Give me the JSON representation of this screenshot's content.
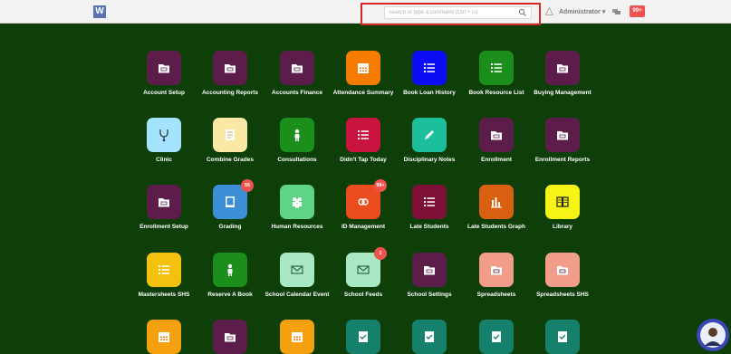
{
  "navbar": {
    "logo": "W",
    "search_placeholder": "Search or type a command (Ctrl + G)",
    "user": "Administrator ▾",
    "notifications": "99+"
  },
  "colors": {
    "background": "#0e3f08",
    "plum": "#5c1d4b",
    "orange": "#f57c00",
    "blue": "#0b0ef4",
    "green": "#1b8e1c",
    "cyan": "#a5e4ff",
    "cream": "#fbe8a5",
    "crimson": "#c8143e",
    "teal": "#1bbf9c",
    "skyblue": "#3b8fd6",
    "mint": "#5fd486",
    "redorange": "#eb4b1e",
    "maroon": "#7e1038",
    "burntorange": "#d96011",
    "yellow": "#f6f316",
    "gold": "#f5c10f",
    "palemint": "#a9e8c5",
    "salmon": "#f29d8a",
    "darkteal": "#15806c"
  },
  "tiles": [
    {
      "label": "Account Setup",
      "icon": "folder-icon",
      "color": "#5c1d4b"
    },
    {
      "label": "Accounting Reports",
      "icon": "folder-icon",
      "color": "#5c1d4b"
    },
    {
      "label": "Accounts Finance",
      "icon": "folder-icon",
      "color": "#5c1d4b"
    },
    {
      "label": "Attendance Summary",
      "icon": "calendar-icon",
      "color": "#f57c00"
    },
    {
      "label": "Book Loan History",
      "icon": "list-icon",
      "color": "#0b0ef4"
    },
    {
      "label": "Book Resource List",
      "icon": "list-icon",
      "color": "#1b8e1c"
    },
    {
      "label": "Buying Management",
      "icon": "folder-icon",
      "color": "#5c1d4b"
    },
    {
      "label": "Clinic",
      "icon": "stethoscope-icon",
      "color": "#a5e4ff"
    },
    {
      "label": "Combine Grades",
      "icon": "note-icon",
      "color": "#fbe8a5"
    },
    {
      "label": "Consultations",
      "icon": "person-icon",
      "color": "#1b8e1c"
    },
    {
      "label": "Didn't Tap Today",
      "icon": "list-icon",
      "color": "#c8143e"
    },
    {
      "label": "Disciplinary Notes",
      "icon": "pencil-icon",
      "color": "#1bbf9c"
    },
    {
      "label": "Enrollment",
      "icon": "folder-icon",
      "color": "#5c1d4b"
    },
    {
      "label": "Enrollment Reports",
      "icon": "folder-icon",
      "color": "#5c1d4b"
    },
    {
      "label": "Enrollment Setup",
      "icon": "folder-icon",
      "color": "#5c1d4b"
    },
    {
      "label": "Grading",
      "icon": "book-icon",
      "color": "#3b8fd6",
      "badge": "55"
    },
    {
      "label": "Human Resources",
      "icon": "people-icon",
      "color": "#5fd486"
    },
    {
      "label": "ID Management",
      "icon": "link-icon",
      "color": "#eb4b1e",
      "badge": "99+"
    },
    {
      "label": "Late Students",
      "icon": "list-icon",
      "color": "#7e1038"
    },
    {
      "label": "Late Students Graph",
      "icon": "bar-chart-icon",
      "color": "#d96011"
    },
    {
      "label": "Library",
      "icon": "open-book-icon",
      "color": "#f6f316"
    },
    {
      "label": "Mastersheets SHS",
      "icon": "list-icon",
      "color": "#f5c10f"
    },
    {
      "label": "Reserve A Book",
      "icon": "person-icon",
      "color": "#1b8e1c"
    },
    {
      "label": "School Calendar Event",
      "icon": "mail-icon",
      "color": "#a9e8c5"
    },
    {
      "label": "School Feeds",
      "icon": "mail-icon",
      "color": "#a9e8c5",
      "badge": "1"
    },
    {
      "label": "School Settings",
      "icon": "folder-icon",
      "color": "#5c1d4b"
    },
    {
      "label": "Spreadsheets",
      "icon": "folder-icon",
      "color": "#f29d8a"
    },
    {
      "label": "Spreadsheets SHS",
      "icon": "folder-icon",
      "color": "#f29d8a"
    },
    {
      "label": "",
      "icon": "calendar-icon",
      "color": "#f5a10f"
    },
    {
      "label": "",
      "icon": "folder-icon",
      "color": "#5c1d4b"
    },
    {
      "label": "",
      "icon": "calendar-icon",
      "color": "#f5a10f"
    },
    {
      "label": "",
      "icon": "check-note-icon",
      "color": "#15806c"
    },
    {
      "label": "",
      "icon": "check-note-icon",
      "color": "#15806c"
    },
    {
      "label": "",
      "icon": "check-note-icon",
      "color": "#15806c"
    },
    {
      "label": "",
      "icon": "check-note-icon",
      "color": "#15806c"
    }
  ]
}
